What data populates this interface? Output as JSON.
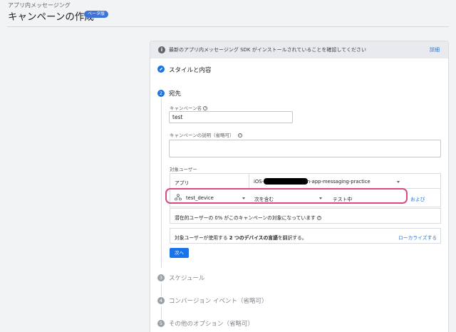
{
  "header": {
    "breadcrumb": "アプリ内メッセージング",
    "title": "キャンペーンの作成",
    "beta_badge": "ベータ版"
  },
  "banner": {
    "text": "最新のアプリ内メッセージング SDK がインストールされていることを確認してください",
    "link": "詳細"
  },
  "steps": {
    "style": {
      "label": "スタイルと内容"
    },
    "target": {
      "number": "2",
      "label": "宛先"
    },
    "schedule": {
      "number": "3",
      "label": "スケジュール"
    },
    "conversion": {
      "number": "4",
      "label": "コンバージョン イベント（省略可）"
    },
    "other": {
      "number": "5",
      "label": "その他のオプション（省略可）"
    }
  },
  "form": {
    "campaign_name_label": "キャンペーン名",
    "campaign_name_value": "test",
    "description_label": "キャンペーンの説明（省略可）",
    "description_value": "",
    "target_users_label": "対象ユーザー",
    "app_label": "アプリ",
    "app_value_prefix": "iOS",
    "app_value_suffix": "in-app-messaging-practice",
    "condition": {
      "field": "test_device",
      "operator": "次を含む",
      "value": "テスト中",
      "and_link": "および"
    },
    "reach_text": "潜在的ユーザーの 0% がこのキャンペーンの対象になっています",
    "language_text_before": "対象ユーザーが使用する ",
    "language_text_bold": "2 つのデバイスの言語",
    "language_text_after": "を翻訳する。",
    "localize_link": "ローカライズする",
    "next_button": "次へ"
  }
}
